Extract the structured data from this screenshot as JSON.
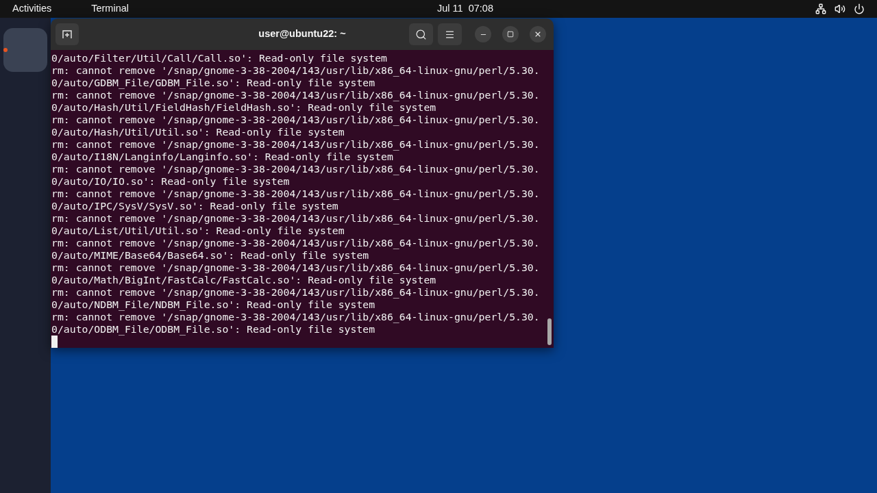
{
  "top_bar": {
    "activities": "Activities",
    "app_menu": "Terminal",
    "clock": "Jul 11  07:08"
  },
  "dock": {
    "items": [
      {
        "running": true
      }
    ]
  },
  "terminal": {
    "title": "user@ubuntu22: ~",
    "lines": [
      "0/auto/Filter/Util/Call/Call.so': Read-only file system",
      "rm: cannot remove '/snap/gnome-3-38-2004/143/usr/lib/x86_64-linux-gnu/perl/5.30.",
      "0/auto/GDBM_File/GDBM_File.so': Read-only file system",
      "rm: cannot remove '/snap/gnome-3-38-2004/143/usr/lib/x86_64-linux-gnu/perl/5.30.",
      "0/auto/Hash/Util/FieldHash/FieldHash.so': Read-only file system",
      "rm: cannot remove '/snap/gnome-3-38-2004/143/usr/lib/x86_64-linux-gnu/perl/5.30.",
      "0/auto/Hash/Util/Util.so': Read-only file system",
      "rm: cannot remove '/snap/gnome-3-38-2004/143/usr/lib/x86_64-linux-gnu/perl/5.30.",
      "0/auto/I18N/Langinfo/Langinfo.so': Read-only file system",
      "rm: cannot remove '/snap/gnome-3-38-2004/143/usr/lib/x86_64-linux-gnu/perl/5.30.",
      "0/auto/IO/IO.so': Read-only file system",
      "rm: cannot remove '/snap/gnome-3-38-2004/143/usr/lib/x86_64-linux-gnu/perl/5.30.",
      "0/auto/IPC/SysV/SysV.so': Read-only file system",
      "rm: cannot remove '/snap/gnome-3-38-2004/143/usr/lib/x86_64-linux-gnu/perl/5.30.",
      "0/auto/List/Util/Util.so': Read-only file system",
      "rm: cannot remove '/snap/gnome-3-38-2004/143/usr/lib/x86_64-linux-gnu/perl/5.30.",
      "0/auto/MIME/Base64/Base64.so': Read-only file system",
      "rm: cannot remove '/snap/gnome-3-38-2004/143/usr/lib/x86_64-linux-gnu/perl/5.30.",
      "0/auto/Math/BigInt/FastCalc/FastCalc.so': Read-only file system",
      "rm: cannot remove '/snap/gnome-3-38-2004/143/usr/lib/x86_64-linux-gnu/perl/5.30.",
      "0/auto/NDBM_File/NDBM_File.so': Read-only file system",
      "rm: cannot remove '/snap/gnome-3-38-2004/143/usr/lib/x86_64-linux-gnu/perl/5.30.",
      "0/auto/ODBM_File/ODBM_File.so': Read-only file system"
    ],
    "cursor_visible": true
  }
}
